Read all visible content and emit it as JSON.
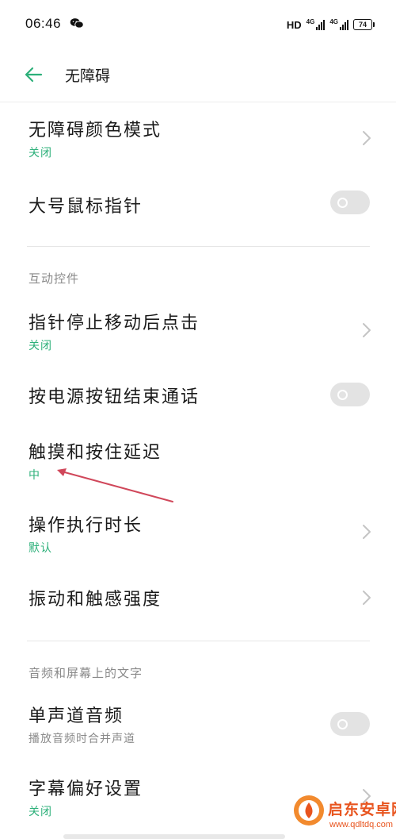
{
  "status_bar": {
    "time": "06:46",
    "hd": "HD",
    "net1": "4G",
    "net2": "4G",
    "battery": "74"
  },
  "header": {
    "title": "无障碍",
    "accent_color": "#2db07a"
  },
  "settings": [
    {
      "title": "无障碍颜色模式",
      "subtitle": "关闭",
      "control": "chevron"
    },
    {
      "title": "大号鼠标指针",
      "control": "toggle",
      "toggle_on": false
    }
  ],
  "section_interaction": {
    "header": "互动控件",
    "items": [
      {
        "title": "指针停止移动后点击",
        "subtitle": "关闭",
        "control": "chevron"
      },
      {
        "title": "按电源按钮结束通话",
        "control": "toggle",
        "toggle_on": false
      },
      {
        "title": "触摸和按住延迟",
        "subtitle": "中",
        "control": "none"
      },
      {
        "title": "操作执行时长",
        "subtitle": "默认",
        "control": "chevron"
      },
      {
        "title": "振动和触感强度",
        "control": "chevron"
      }
    ]
  },
  "section_audio": {
    "header": "音频和屏幕上的文字",
    "items": [
      {
        "title": "单声道音频",
        "subtitle": "播放音频时合并声道",
        "control": "toggle",
        "toggle_on": false
      },
      {
        "title": "字幕偏好设置",
        "subtitle": "关闭",
        "control": "chevron"
      }
    ]
  },
  "annotation": {
    "color": "#d0475a"
  },
  "watermark": {
    "name": "启东安卓网",
    "url": "www.qdltdq.com",
    "color": "#e8541e"
  }
}
